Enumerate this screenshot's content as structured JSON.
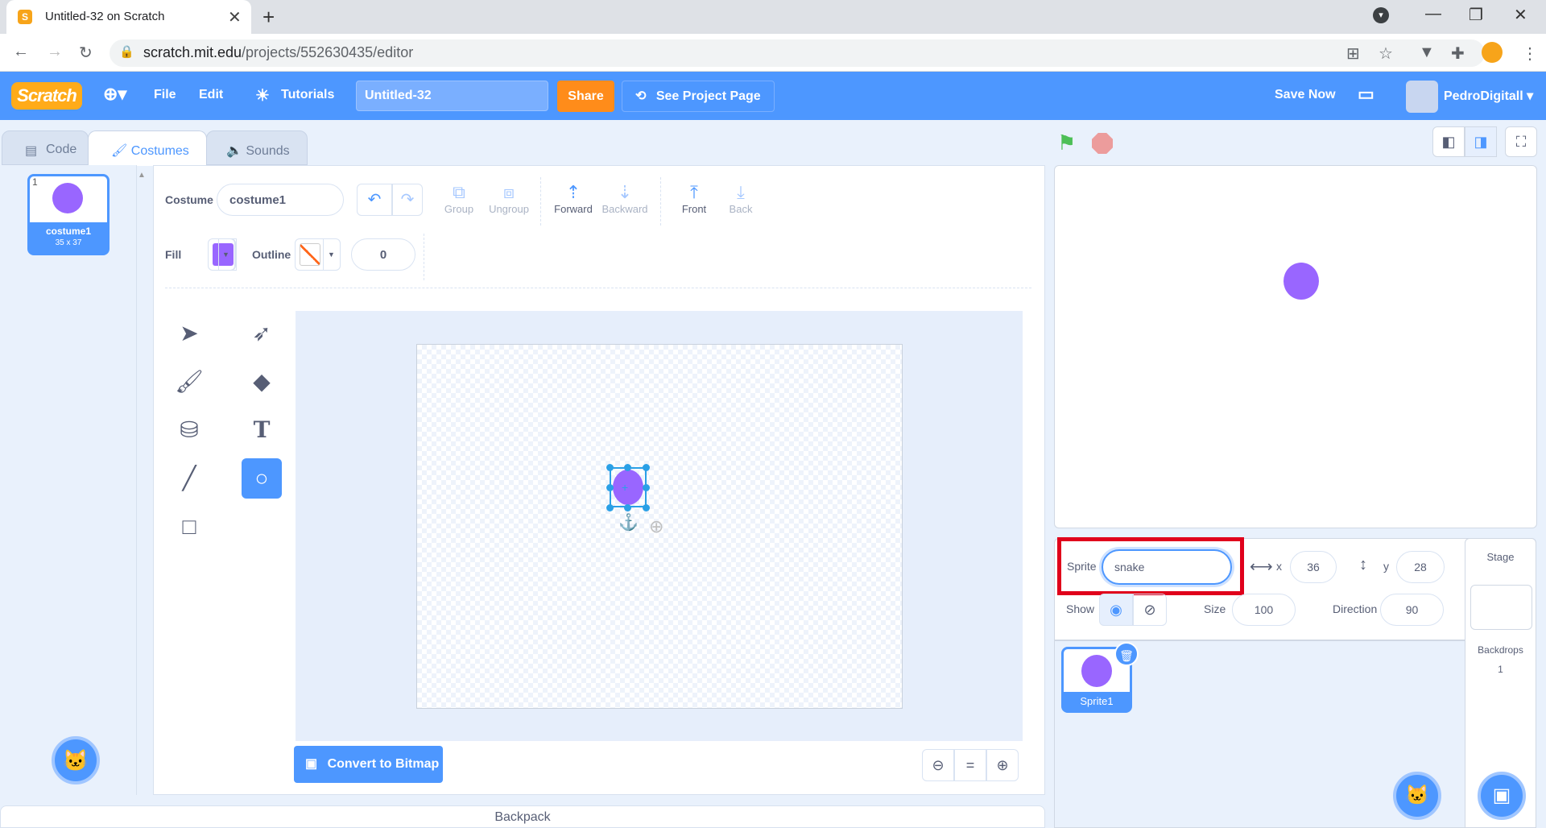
{
  "browser": {
    "tab_title": "Untitled-32 on Scratch",
    "tab_favicon": "S",
    "url_host": "scratch.mit.edu",
    "url_path": "/projects/552630435/editor"
  },
  "menubar": {
    "logo": "Scratch",
    "file": "File",
    "edit": "Edit",
    "tutorials": "Tutorials",
    "project_title": "Untitled-32",
    "share": "Share",
    "see_project_page": "See Project Page",
    "save_now": "Save Now",
    "username": "PedroDigitall"
  },
  "tabs": {
    "code": "Code",
    "costumes": "Costumes",
    "sounds": "Sounds"
  },
  "costume_list": [
    {
      "number": "1",
      "name": "costume1",
      "size": "35 x 37"
    }
  ],
  "paint": {
    "costume_label": "Costume",
    "costume_name": "costume1",
    "group": "Group",
    "ungroup": "Ungroup",
    "forward": "Forward",
    "backward": "Backward",
    "front": "Front",
    "back": "Back",
    "fill_label": "Fill",
    "outline_label": "Outline",
    "outline_width": "0",
    "fill_color": "#9966ff",
    "convert": "Convert to Bitmap",
    "selected_tool": "circle"
  },
  "backpack": "Backpack",
  "sprite_info": {
    "sprite_label": "Sprite",
    "sprite_name": "snake",
    "x_label": "x",
    "x": "36",
    "y_label": "y",
    "y": "28",
    "show_label": "Show",
    "size_label": "Size",
    "size": "100",
    "direction_label": "Direction",
    "direction": "90"
  },
  "sprites": [
    {
      "name": "Sprite1"
    }
  ],
  "stage_panel": {
    "label": "Stage",
    "backdrops_label": "Backdrops",
    "backdrops_count": "1"
  },
  "colors": {
    "accent": "#4d97ff",
    "share": "#ff8c1a",
    "sprite": "#9966ff",
    "highlight": "#e0001b"
  }
}
